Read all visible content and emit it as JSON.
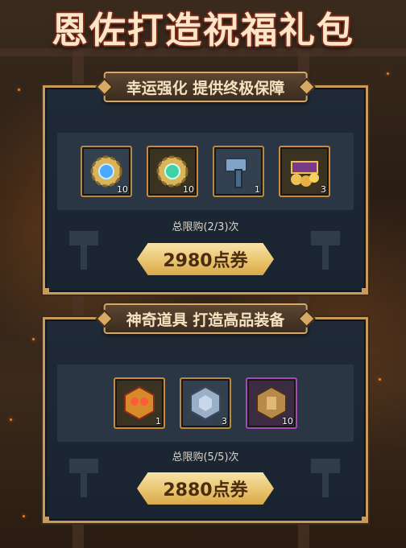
{
  "title": "恩佐打造祝福礼包",
  "packs": [
    {
      "heading": "幸运强化 提供终极保障",
      "items": [
        {
          "icon": "blue-gear-gem-icon",
          "qty": "10"
        },
        {
          "icon": "green-gear-gem-icon",
          "qty": "10"
        },
        {
          "icon": "blue-hammer-icon",
          "qty": "1"
        },
        {
          "icon": "treasure-chest-gold-icon",
          "qty": "3"
        }
      ],
      "limit": "总限购(2/3)次",
      "price": "2980点券"
    },
    {
      "heading": "神奇道具 打造高品装备",
      "items": [
        {
          "icon": "red-gold-cube-icon",
          "qty": "1"
        },
        {
          "icon": "silver-cube-icon",
          "qty": "3"
        },
        {
          "icon": "bronze-cube-icon",
          "qty": "10"
        }
      ],
      "limit": "总限购(5/5)次",
      "price": "2880点券"
    }
  ],
  "colors": {
    "frame": "#c99a5a",
    "panel": "#1f2a36",
    "button": "#e9c56e"
  }
}
